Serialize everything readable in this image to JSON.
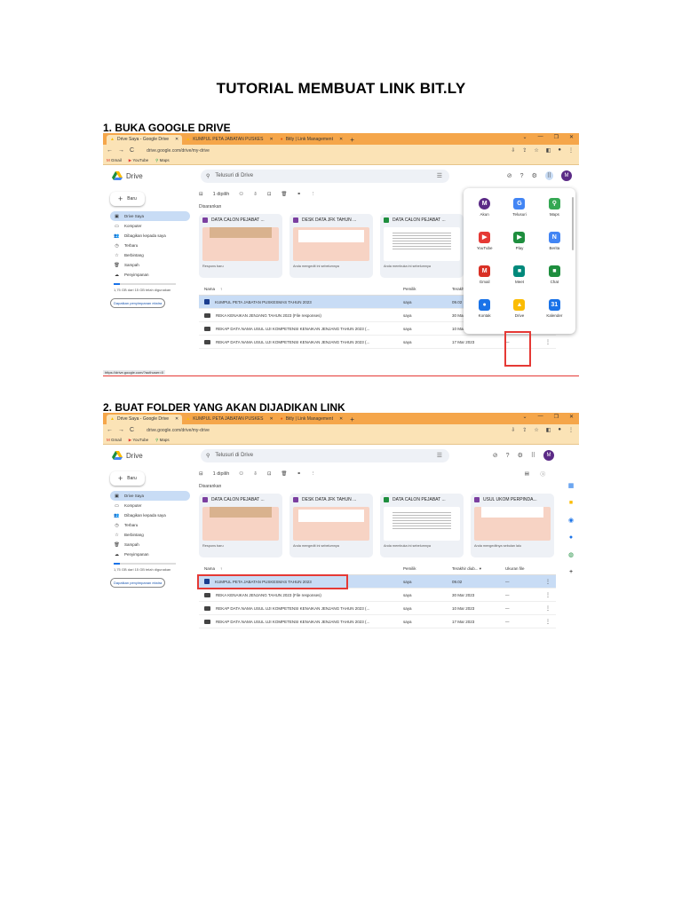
{
  "document": {
    "title": "TUTORIAL MEMBUAT LINK BIT.LY",
    "step1": "1. BUKA GOOGLE DRIVE",
    "step2": "2. BUAT FOLDER YANG AKAN DIJADIKAN LINK"
  },
  "browser": {
    "tabs": [
      "Drive Saya - Google Drive",
      "KUMPUL PETA JABATAN PUSKES",
      "Bitly | Link Management"
    ],
    "url": "drive.google.com/drive/my-drive",
    "bookmarks": [
      "Gmail",
      "YouTube",
      "Maps"
    ],
    "status_url": "https://drive.google.com/?authuser=0"
  },
  "drive": {
    "app_name": "Drive",
    "search_placeholder": "Telusuri di Drive",
    "new_label": "Baru",
    "selected_count": "1 dipilih",
    "suggested_label": "Disarankan",
    "sidebar": [
      "Drive Saya",
      "Komputer",
      "Dibagikan kepada saya",
      "Terbaru",
      "Berbintang",
      "Sampah",
      "Penyimpanan"
    ],
    "storage_text": "1,75 GB dari 15 GB telah digunakan",
    "storage_button": "Dapatkan penyimpanan ekstra",
    "cards": [
      {
        "title": "DATA CALON PEJABAT ...",
        "sub": "Respons baru"
      },
      {
        "title": "DESK DATA JFK TAHUN ...",
        "sub": "Anda mengedit ini sebelumnya"
      },
      {
        "title": "DATA CALON PEJABAT ...",
        "sub": "Anda membuka ini sebelumnya"
      },
      {
        "title": "USUL UKOM PERPINDA...",
        "sub": "Anda mengeditnya sebulan lalu"
      }
    ],
    "columns": {
      "name": "Nama",
      "owner": "Pemilik",
      "modified": "Terakhir diub...",
      "size": "Ukuran file"
    },
    "rows": [
      {
        "name": "KUMPUL PETA JABATAN PUSKESMAS TAHUN 2023",
        "owner": "saya",
        "date": "09.02",
        "size": "—"
      },
      {
        "name": "REKA KENAIKAN JENJANG TAHUN 2023 (File responses)",
        "owner": "saya",
        "date": "30 Mar 2023",
        "size": "—"
      },
      {
        "name": "REKAP DATA NAMA USUL UJI KOMPETENSI KENAIKAN JENJANG TAHUN 2023 (...",
        "owner": "saya",
        "date": "10 Mar 2023",
        "size": "—"
      },
      {
        "name": "REKAP DATA NAMA USUL UJI KOMPETENSI KENAIKAN JENJANG TAHUN 2023 (...",
        "owner": "saya",
        "date": "17 Mar 2023",
        "size": "—"
      }
    ]
  },
  "launcher": {
    "apps": [
      {
        "label": "Akun",
        "glyph": "M",
        "color": "#5b2a86"
      },
      {
        "label": "Telusuri",
        "glyph": "G",
        "color": "#4285f4"
      },
      {
        "label": "Maps",
        "glyph": "⚲",
        "color": "#34a853"
      },
      {
        "label": "YouTube",
        "glyph": "▶",
        "color": "#e53935"
      },
      {
        "label": "Play",
        "glyph": "▶",
        "color": "#1e8e3e"
      },
      {
        "label": "Berita",
        "glyph": "N",
        "color": "#4285f4"
      },
      {
        "label": "Gmail",
        "glyph": "M",
        "color": "#d93025"
      },
      {
        "label": "Meet",
        "glyph": "■",
        "color": "#00897b"
      },
      {
        "label": "Chat",
        "glyph": "■",
        "color": "#1e8e3e"
      },
      {
        "label": "Kontak",
        "glyph": "●",
        "color": "#1a73e8"
      },
      {
        "label": "Drive",
        "glyph": "▲",
        "color": "#fbbc04"
      },
      {
        "label": "Kalender",
        "glyph": "31",
        "color": "#1a73e8"
      }
    ]
  },
  "colors": {
    "chrome": "#f5a64a",
    "chrome_light": "#fbe3b6",
    "highlight": "#e53935",
    "selection": "#c8dcf5"
  }
}
